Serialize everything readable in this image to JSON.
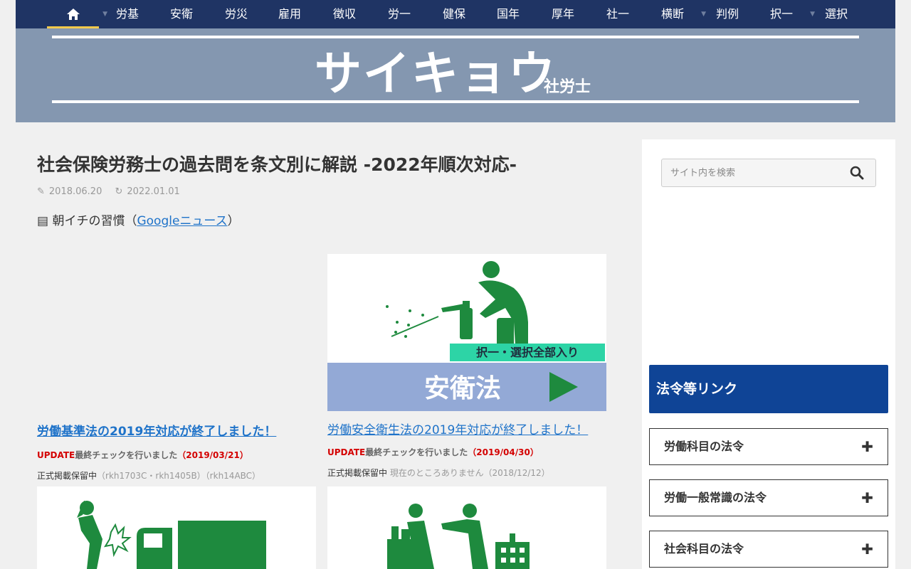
{
  "nav": {
    "items": [
      "労基",
      "安衛",
      "労災",
      "雇用",
      "徴収",
      "労一",
      "健保",
      "国年",
      "厚年",
      "社一",
      "横断",
      "判例",
      "択一",
      "選択"
    ]
  },
  "header": {
    "logo_main": "サイキョウ",
    "logo_sub": "社労士"
  },
  "article": {
    "title": "社会保険労務士の過去問を条文別に解説 -2022年順次対応-",
    "published": "2018.06.20",
    "updated": "2022.01.01",
    "intro_prefix": "朝イチの習慣（",
    "intro_link": "Googleニュース",
    "intro_suffix": "）"
  },
  "cards": [
    {
      "link": "労働基準法の2019年対応が終了しました！",
      "update_label": "UPDATE",
      "update_text": "最終チェックを行いました",
      "update_date": "（2019/03/21）",
      "keep_label": "正式掲載保留中",
      "keep_text": "（rkh1703C・rkh1405B）（rkh14ABC）"
    },
    {
      "link": "労働安全衛生法の2019年対応が終了しました！",
      "image_banner": "択一・選択全部入り",
      "image_title": "安衛法",
      "update_label": "UPDATE",
      "update_text": "最終チェックを行いました",
      "update_date": "（2019/04/30）",
      "keep_label": "正式掲載保留中",
      "keep_text": " 現在のところありません（2018/12/12）"
    }
  ],
  "sidebar": {
    "search_placeholder": "サイト内を検索",
    "links_title": "法令等リンク",
    "accordions": [
      "労働科目の法令",
      "労働一般常識の法令",
      "社会科目の法令"
    ]
  },
  "colors": {
    "nav_bg": "#1f3464",
    "header_bg": "#8497b0",
    "link": "#1f73c9",
    "accent_green": "#1e8a3e",
    "links_head": "#0f4496"
  }
}
